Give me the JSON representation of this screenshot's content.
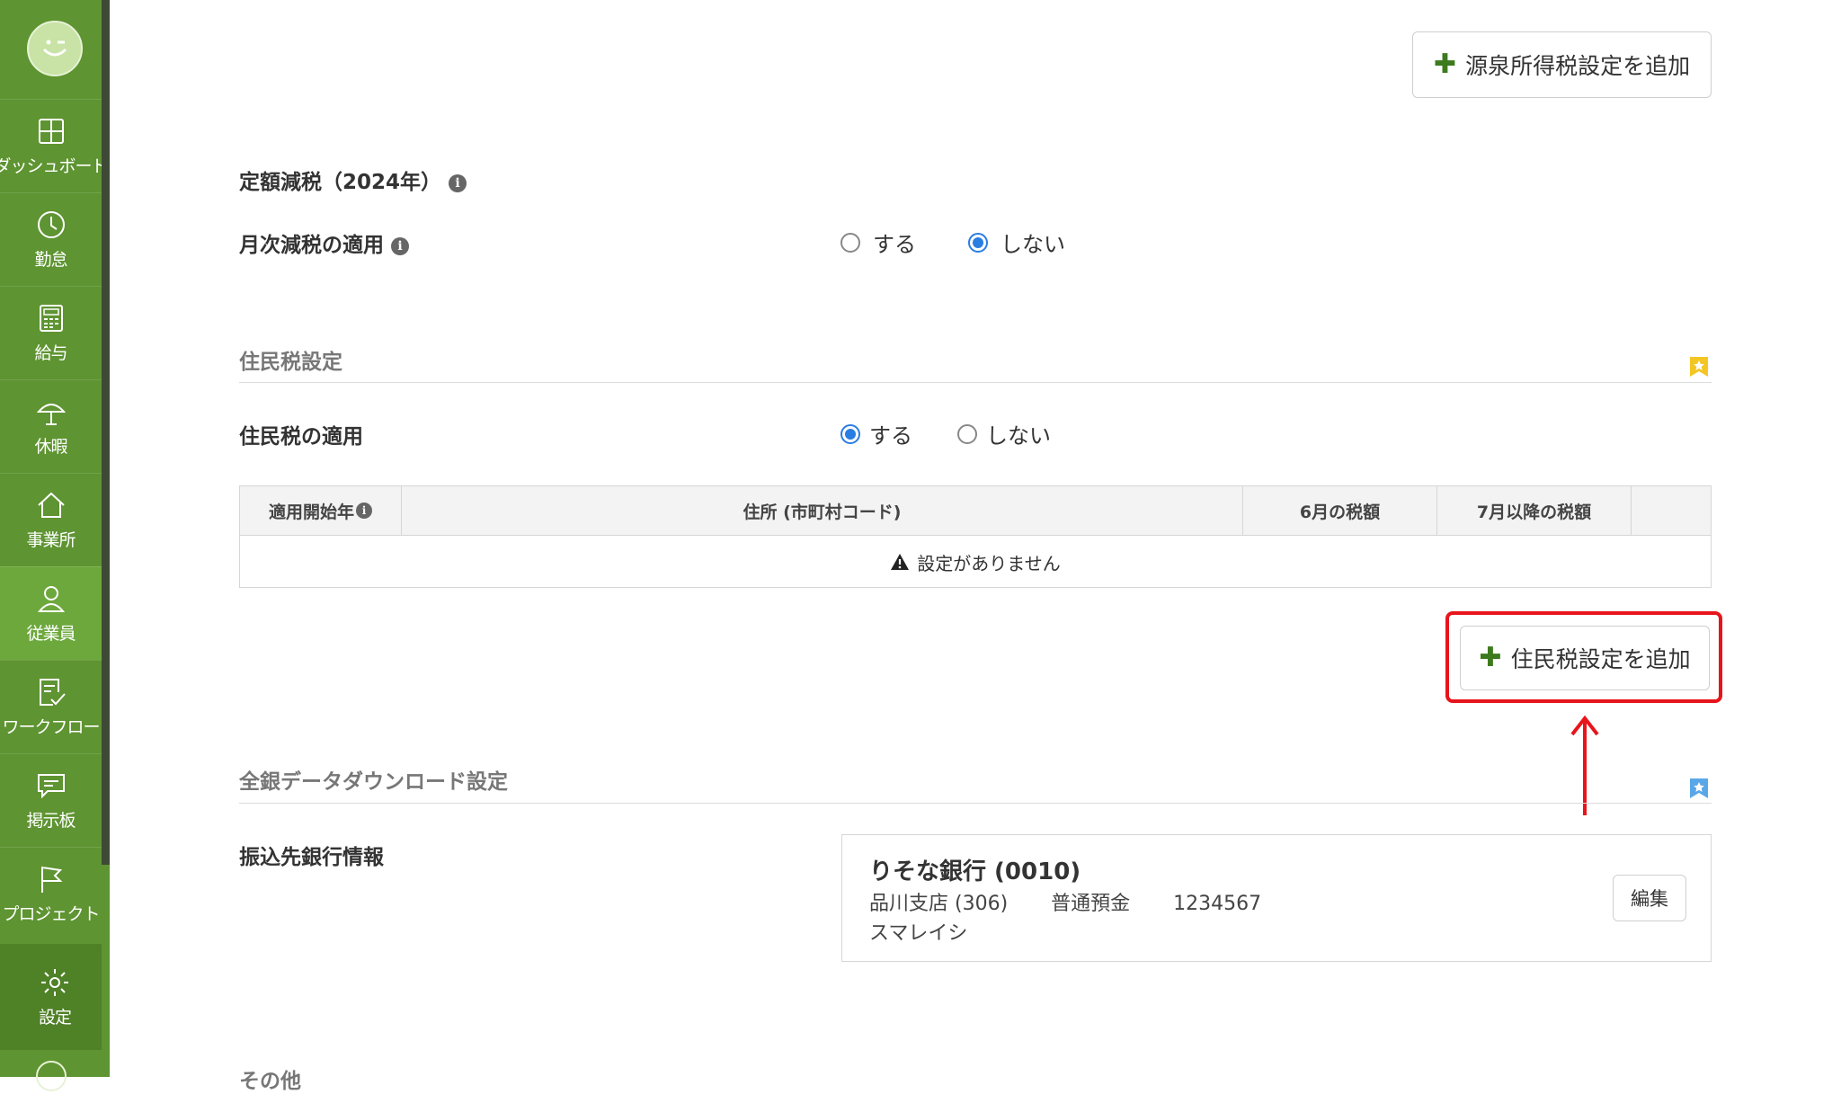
{
  "sidebar": {
    "items": [
      {
        "label": "ダッシュボード",
        "icon": "dashboard-icon"
      },
      {
        "label": "勤怠",
        "icon": "clock-icon"
      },
      {
        "label": "給与",
        "icon": "calculator-icon"
      },
      {
        "label": "休暇",
        "icon": "beach-umbrella-icon"
      },
      {
        "label": "事業所",
        "icon": "home-icon"
      },
      {
        "label": "従業員",
        "icon": "person-icon"
      },
      {
        "label": "ワークフロー",
        "icon": "checklist-icon"
      },
      {
        "label": "掲示板",
        "icon": "chat-bubble-icon"
      },
      {
        "label": "プロジェクト",
        "icon": "flag-icon"
      }
    ],
    "settings_label": "設定",
    "active_item": "従業員"
  },
  "withholding": {
    "add_button": "源泉所得税設定を追加"
  },
  "fixed_tax": {
    "title": "定額減税（2024年）",
    "monthly_label": "月次減税の適用",
    "option_yes": "する",
    "option_no": "しない",
    "selected": "しない"
  },
  "resident_tax": {
    "section_title": "住民税設定",
    "apply_label": "住民税の適用",
    "option_yes": "する",
    "option_no": "しない",
    "selected": "する",
    "table": {
      "headers": [
        "適用開始年",
        "住所 (市町村コード)",
        "6月の税額",
        "7月以降の税額",
        ""
      ],
      "empty_message": "設定がありません"
    },
    "add_button": "住民税設定を追加"
  },
  "bank_download": {
    "section_title": "全銀データダウンロード設定",
    "label": "振込先銀行情報",
    "bank_name": "りそな銀行 (0010)",
    "branch": "品川支店 (306)",
    "account_type": "普通預金",
    "account_number": "1234567",
    "account_holder": "スマレイシ",
    "edit_button": "編集"
  },
  "other": {
    "section_title": "その他"
  },
  "colors": {
    "sidebar": "#5e9431",
    "accent": "#2a7de1",
    "highlight": "#e8141b",
    "plus": "#3d7a1e"
  }
}
